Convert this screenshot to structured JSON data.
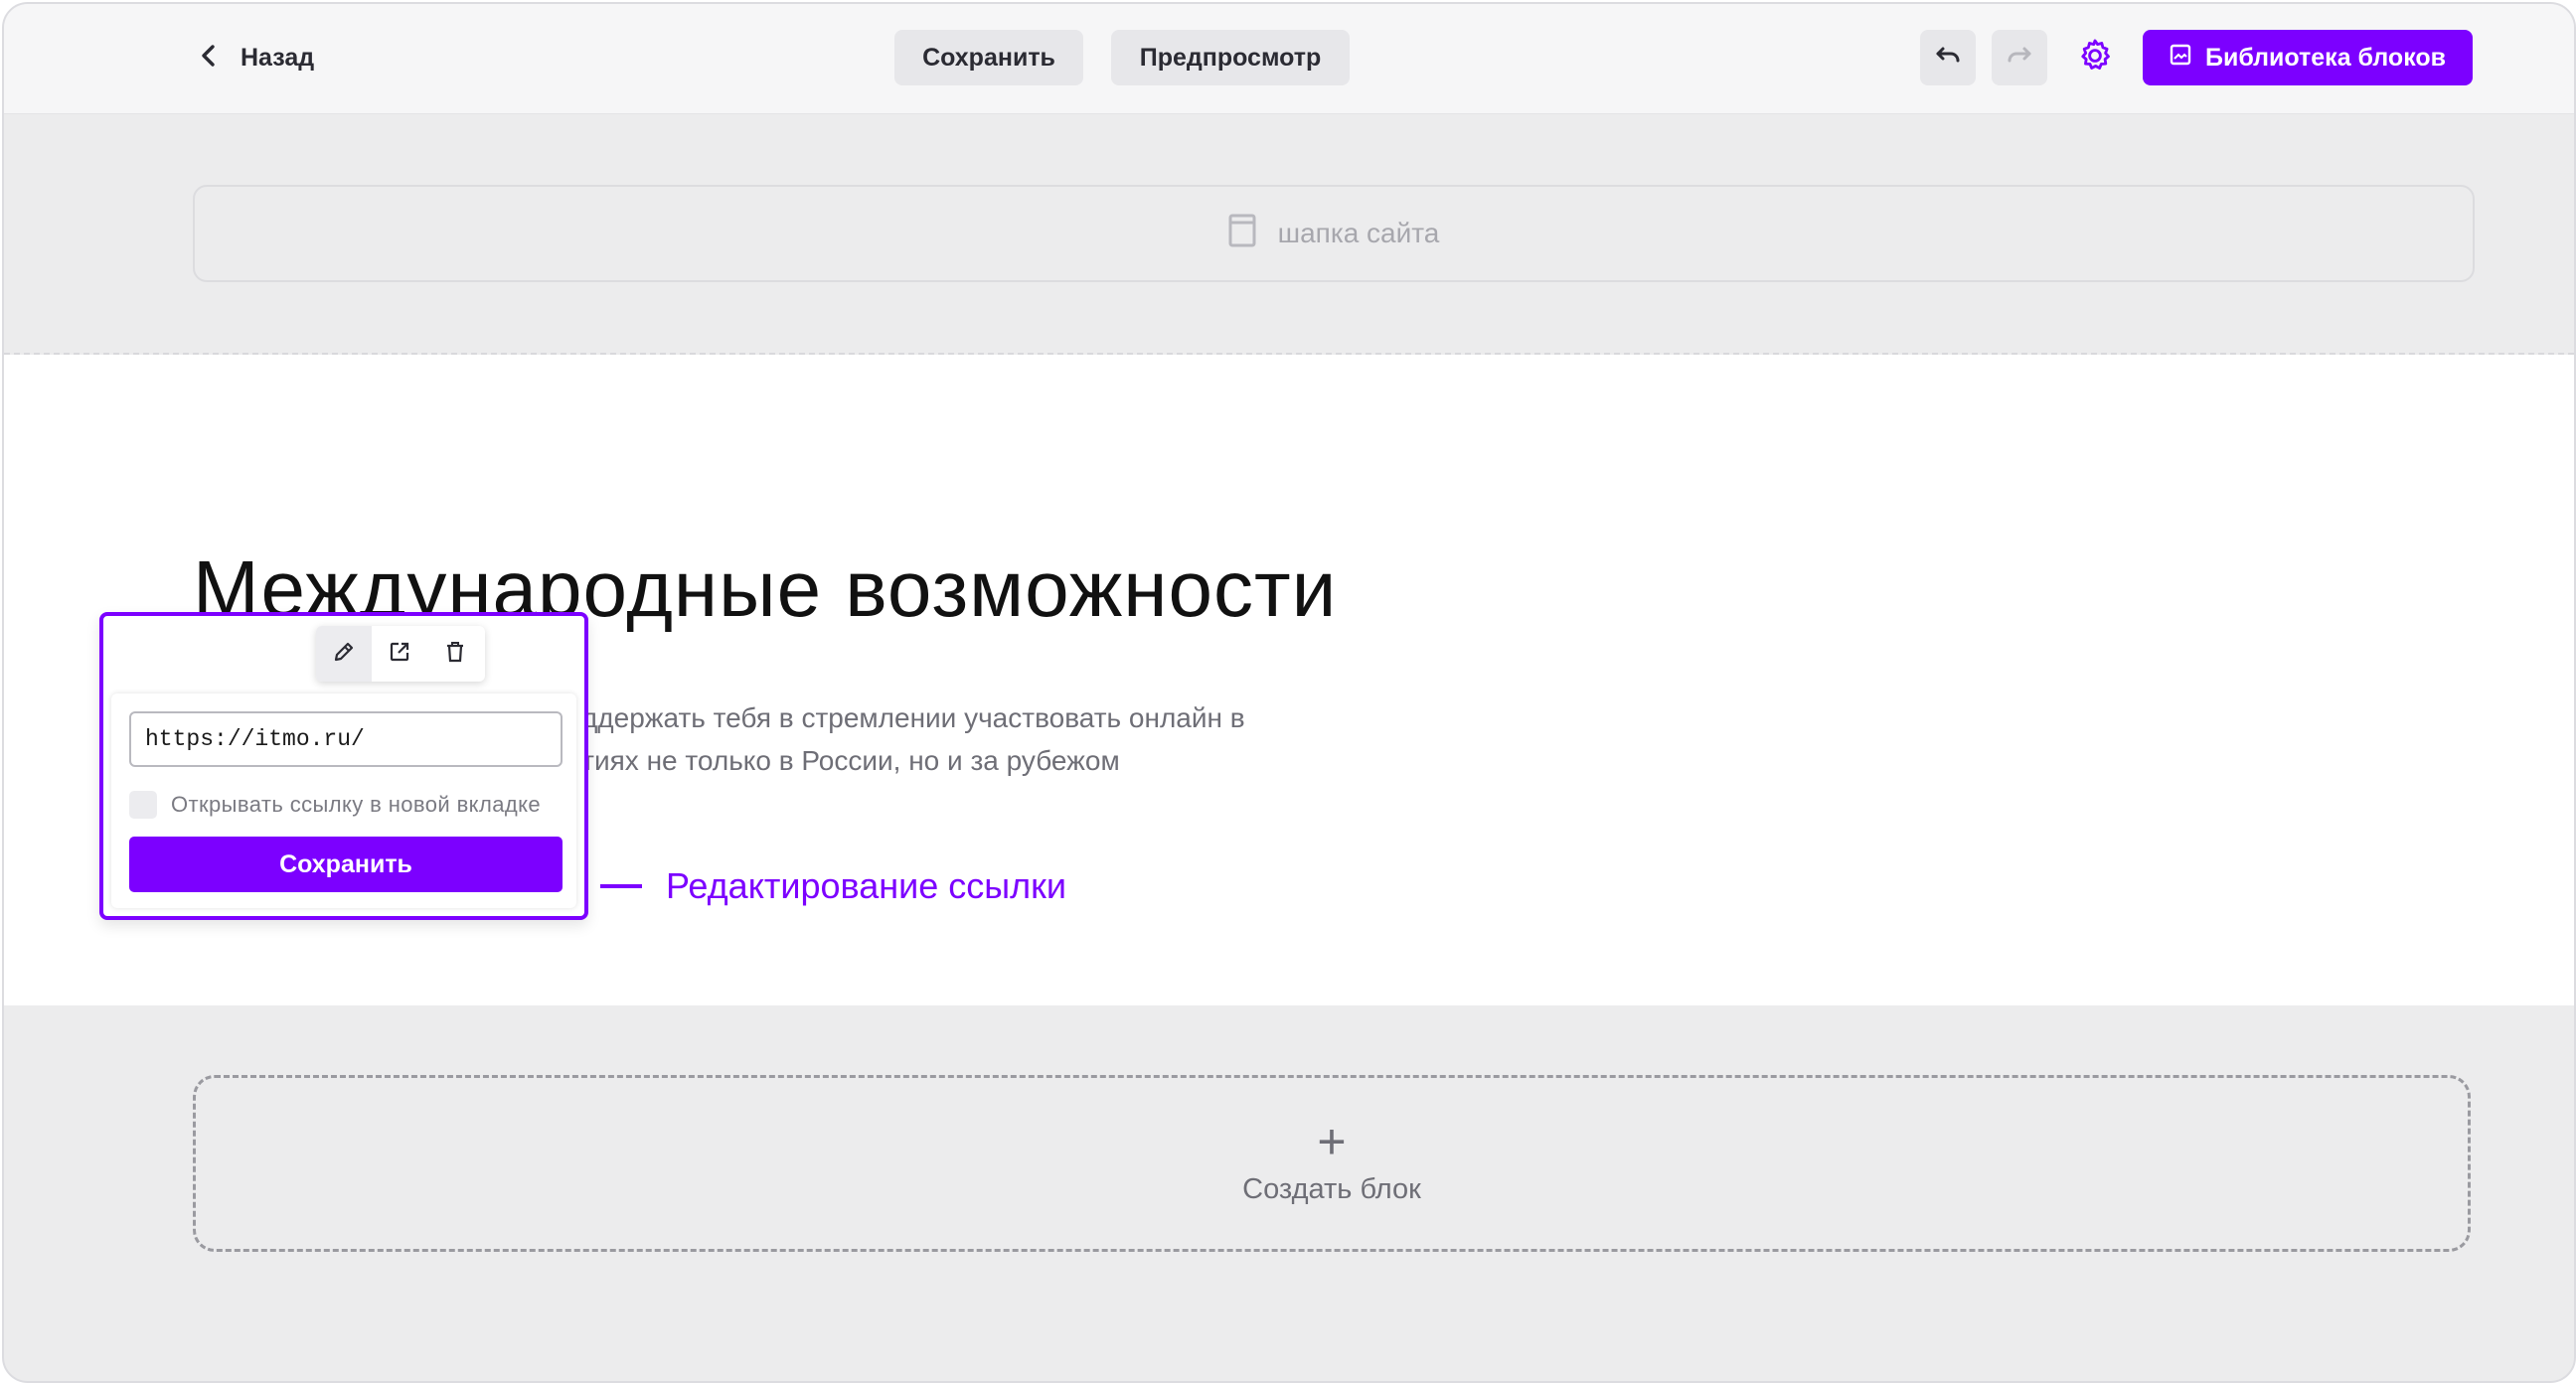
{
  "toolbar": {
    "back_label": "Назад",
    "save_label": "Сохранить",
    "preview_label": "Предпросмотр",
    "library_label": "Библиотека блоков"
  },
  "header_placeholder": {
    "label": "шапка сайта"
  },
  "content": {
    "title": "Международные возможности",
    "description": "оддержать тебя в стремлении участвовать онлайн в \nятиях не только в России, но и за рубежом"
  },
  "link_editor": {
    "url_value": "https://itmo.ru/",
    "new_tab_label": "Открывать ссылку в новой вкладке",
    "new_tab_checked": false,
    "save_label": "Сохранить"
  },
  "annotation": {
    "label": "Редактирование ссылки"
  },
  "create_block": {
    "plus": "+",
    "label": "Создать блок"
  },
  "colors": {
    "accent": "#7c00ff",
    "panel_bg": "#ececed",
    "text_muted": "#6e6e76"
  },
  "icons": [
    "chevron-left-icon",
    "undo-icon",
    "redo-icon",
    "gear-icon",
    "image-icon",
    "page-icon",
    "pencil-icon",
    "external-link-icon",
    "trash-icon",
    "plus-icon"
  ]
}
